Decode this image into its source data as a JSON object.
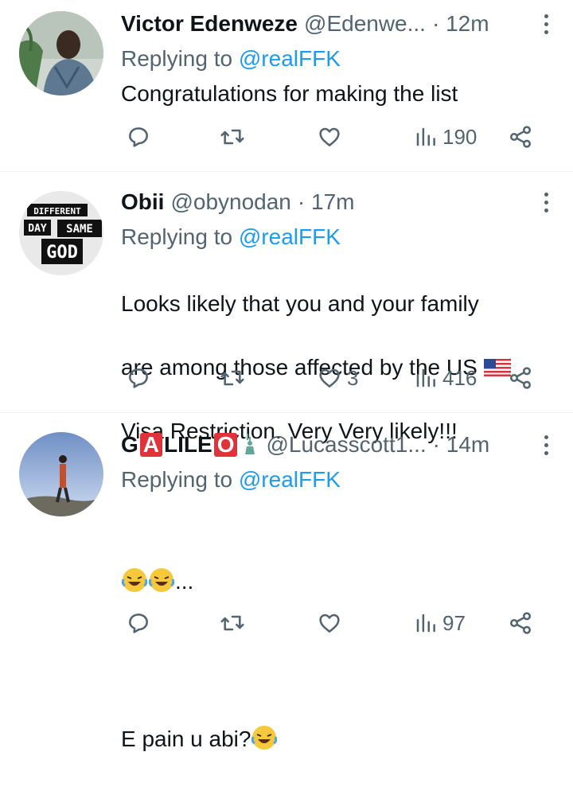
{
  "tweets": [
    {
      "name": "Victor Edenweze",
      "handle": "@Edenwe...",
      "time": "· 12m",
      "replying_prefix": "Replying to ",
      "mention": "@realFFK",
      "text": "Congratulations for making the list",
      "stats": {
        "replies": "",
        "retweets": "",
        "likes": "",
        "views": "190"
      }
    },
    {
      "name": "Obii",
      "handle": "@obynodan",
      "time": "· 17m",
      "replying_prefix": "Replying to ",
      "mention": "@realFFK",
      "text_line1": "Looks likely that you and your family",
      "text_line2": "are among those affected by the US",
      "text_line3": "Visa Restriction.  Very Very likely!!!",
      "avatar_text": [
        "DIFFERENT",
        "DAY",
        "SAME",
        "GOD"
      ],
      "stats": {
        "replies": "",
        "retweets": "",
        "likes": "3",
        "views": "416"
      }
    },
    {
      "name_parts": [
        "G",
        "A",
        "LILE",
        "O"
      ],
      "handle": "@Lucasscott1...",
      "time": "· 14m",
      "replying_prefix": "Replying to ",
      "mention": "@realFFK",
      "text_line1": "...",
      "text_line2": "E pain u abi?",
      "stats": {
        "replies": "",
        "retweets": "",
        "likes": "",
        "views": "97"
      }
    }
  ],
  "icons": [
    "reply-icon",
    "retweet-icon",
    "like-icon",
    "views-icon",
    "share-icon",
    "more-icon"
  ],
  "colors": {
    "text": "#0f1419",
    "secondary": "#536471",
    "link": "#1d9bf0",
    "divider": "#eff3f4"
  }
}
